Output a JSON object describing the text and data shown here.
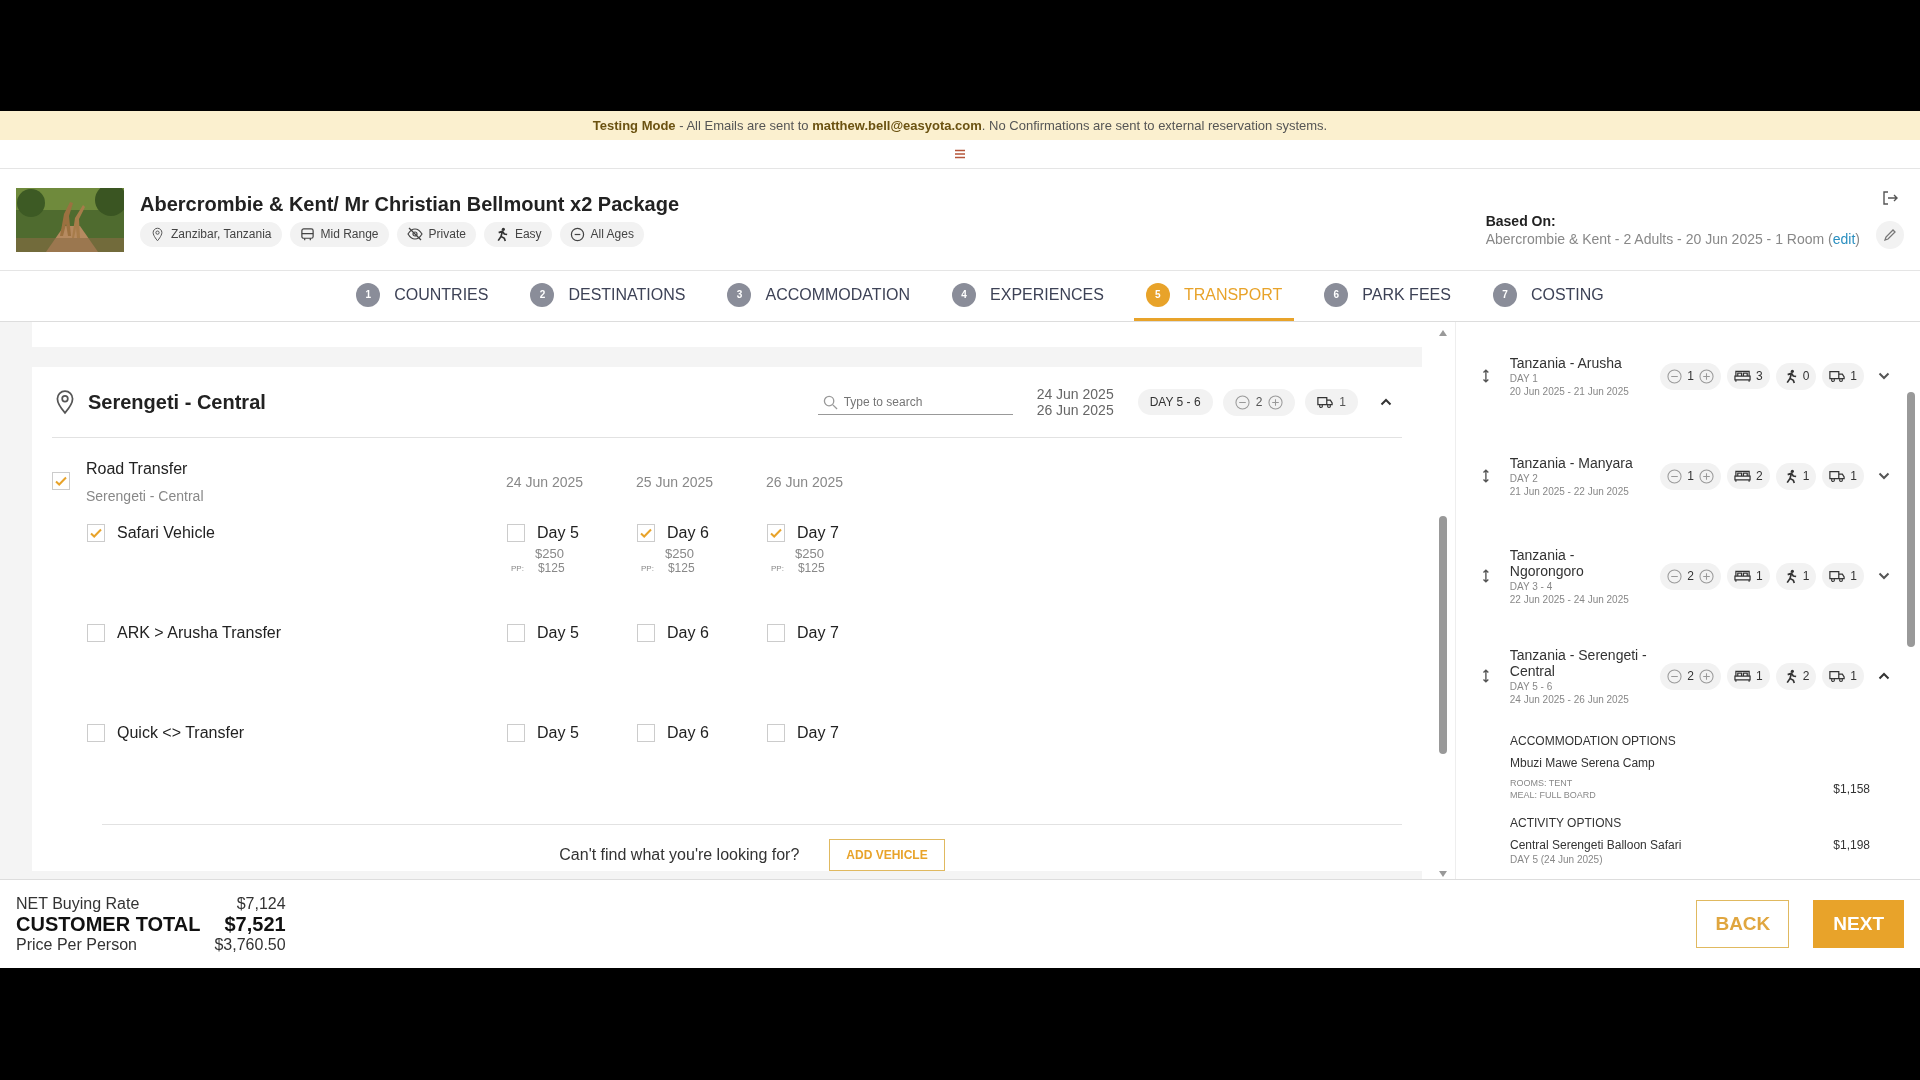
{
  "banner": "**Testing Mode** - All Emails are sent to **matthew.bell@easyota.com**. No Confirmations are sent to external reservation systems.",
  "header": {
    "title": "Abercrombie & Kent/ Mr Christian Bellmount x2 Package",
    "tags": [
      {
        "label": "Zanzibar, Tanzania"
      },
      {
        "label": "Mid Range"
      },
      {
        "label": "Private"
      },
      {
        "label": "Easy"
      },
      {
        "label": "All Ages"
      }
    ],
    "based_on": {
      "label": "Based On:",
      "text": "Abercrombie & Kent - 2 Adults - 20 Jun 2025 - 1 Room (",
      "link": "edit",
      "text_after": ")"
    }
  },
  "tabs": [
    {
      "number": "1",
      "label": "COUNTRIES",
      "selected": false
    },
    {
      "number": "2",
      "label": "DESTINATIONS",
      "selected": false
    },
    {
      "number": "3",
      "label": "ACCOMMODATION",
      "selected": false
    },
    {
      "number": "4",
      "label": "EXPERIENCES",
      "selected": false
    },
    {
      "number": "5",
      "label": "TRANSPORT",
      "selected": true
    },
    {
      "number": "6",
      "label": "PARK FEES",
      "selected": false
    },
    {
      "number": "7",
      "label": "COSTING",
      "selected": false
    }
  ],
  "destination": {
    "name": "Serengeti - Central",
    "search": {
      "placeholder": "Type to search"
    },
    "dates": [
      "24 Jun 2025",
      "26 Jun 2025"
    ],
    "day_range": "DAY 5 - 6",
    "nights": "2",
    "vehicles": "1",
    "expanded": true,
    "transfer": {
      "label": "Road Transfer",
      "sublabel": "Serengeti - Central",
      "checked": true,
      "columns": [
        "24 Jun 2025",
        "25 Jun 2025",
        "26 Jun 2025"
      ],
      "options": [
        {
          "name": "Safari Vehicle",
          "checked": true,
          "days": [
            {
              "label": "Day 5",
              "checked": false,
              "price": "$250",
              "pp_label": "PP:",
              "pp": "$125"
            },
            {
              "label": "Day 6",
              "checked": true,
              "price": "$250",
              "pp_label": "PP:",
              "pp": "$125"
            },
            {
              "label": "Day 7",
              "checked": true,
              "price": "$250",
              "pp_label": "PP:",
              "pp": "$125"
            }
          ]
        },
        {
          "name": "ARK > Arusha Transfer",
          "checked": false,
          "days": [
            {
              "label": "Day 5",
              "checked": false
            },
            {
              "label": "Day 6",
              "checked": false
            },
            {
              "label": "Day 7",
              "checked": false
            }
          ]
        },
        {
          "name": "Quick <> Transfer",
          "checked": false,
          "days": [
            {
              "label": "Day 5",
              "checked": false
            },
            {
              "label": "Day 6",
              "checked": false
            },
            {
              "label": "Day 7",
              "checked": false
            }
          ]
        }
      ]
    },
    "add_vehicle": {
      "prompt": "Can't find what you're looking for?",
      "button": "ADD VEHICLE"
    }
  },
  "itinerary": [
    {
      "name": "Tanzania - Arusha",
      "day": "DAY 1",
      "dates": "20 Jun 2025 - 21 Jun 2025",
      "nights": "1",
      "rooms": "3",
      "activities": "0",
      "vehicles": "1",
      "expanded": false
    },
    {
      "name": "Tanzania - Manyara",
      "day": "DAY 2",
      "dates": "21 Jun 2025 - 22 Jun 2025",
      "nights": "1",
      "rooms": "2",
      "activities": "1",
      "vehicles": "1",
      "expanded": false
    },
    {
      "name": "Tanzania - Ngorongoro",
      "day": "DAY 3 - 4",
      "dates": "22 Jun 2025 - 24 Jun 2025",
      "nights": "2",
      "rooms": "1",
      "activities": "1",
      "vehicles": "1",
      "expanded": false
    },
    {
      "name": "Tanzania - Serengeti - Central",
      "day": "DAY 5 - 6",
      "dates": "24 Jun 2025 - 26 Jun 2025",
      "nights": "2",
      "rooms": "1",
      "activities": "2",
      "vehicles": "1",
      "expanded": true
    }
  ],
  "details": {
    "accommodation_heading": "ACCOMMODATION OPTIONS",
    "hotel": "Mbuzi Mawe Serena Camp",
    "rooms": "ROOMS: TENT",
    "meal": "MEAL: FULL BOARD",
    "hotel_price": "$1,158",
    "activity_heading": "ACTIVITY OPTIONS",
    "activity": "Central Serengeti Balloon Safari",
    "activity_day": "DAY 5  (24 Jun 2025)",
    "activity_price": "$1,198"
  },
  "totals": [
    {
      "label": "NET Buying Rate",
      "value": "$7,124",
      "kind": "normal"
    },
    {
      "label": "CUSTOMER TOTAL",
      "value": "$7,521",
      "kind": "total"
    },
    {
      "label": "Price Per Person",
      "value": "$3,760.50",
      "kind": "normal"
    }
  ],
  "buttons": {
    "back": "BACK",
    "next": "NEXT"
  }
}
